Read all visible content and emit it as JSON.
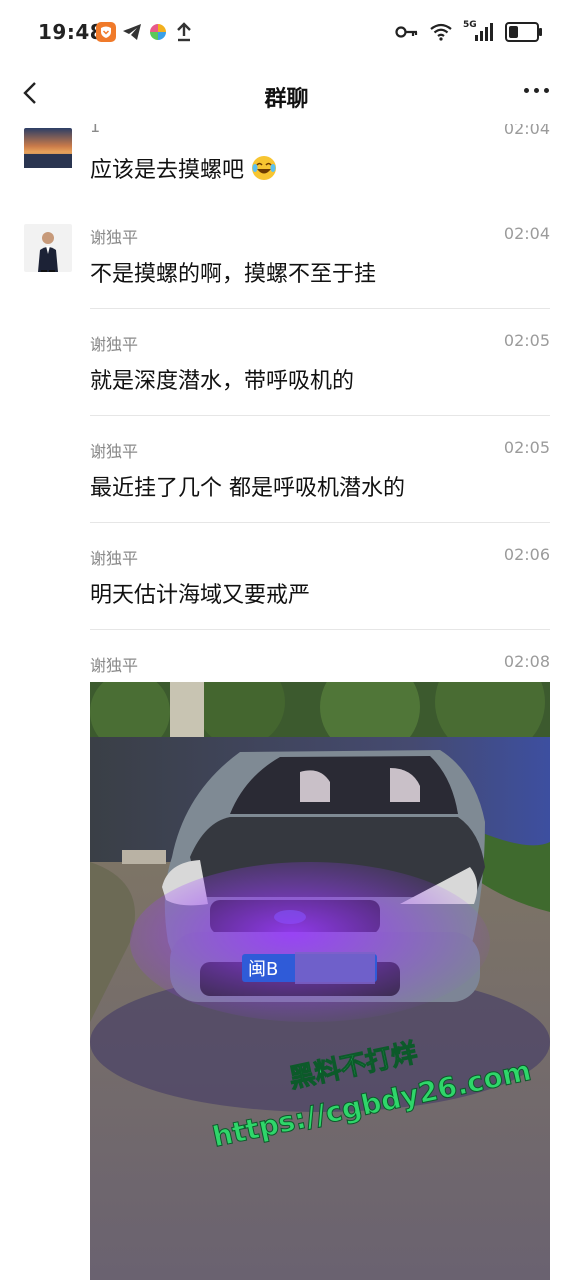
{
  "status_bar": {
    "time": "19:48",
    "left_icons": [
      "shield-app-icon",
      "telegram-icon",
      "pinwheel-icon",
      "upload-icon"
    ],
    "right_icons": [
      "key-icon",
      "wifi-icon",
      "5g-signal-icon",
      "battery-icon"
    ],
    "network_label": "5G",
    "battery_level_percent": 35
  },
  "nav": {
    "title": "群聊"
  },
  "messages": [
    {
      "sender": "1",
      "time": "02:04",
      "text": "应该是去摸螺吧",
      "emoji": "laughing-crying-emoji"
    },
    {
      "sender": "谢独平",
      "time": "02:04",
      "text": "不是摸螺的啊，摸螺不至于挂"
    },
    {
      "sender": "谢独平",
      "time": "02:05",
      "text": "就是深度潜水，带呼吸机的"
    },
    {
      "sender": "谢独平",
      "time": "02:05",
      "text": "最近挂了几个 都是呼吸机潜水的"
    },
    {
      "sender": "谢独平",
      "time": "02:06",
      "text": "明天估计海域又要戒严"
    },
    {
      "sender": "谢独平",
      "time": "02:08",
      "image": "car-photo"
    }
  ],
  "photo": {
    "plate_text": "闽B",
    "watermark_line1": "黑料不打烊",
    "watermark_line2": "https://cgbdy26.com"
  },
  "colors": {
    "divider": "#e6e6e6",
    "meta_text": "#8a8a8a",
    "watermark": "#2fd66a"
  }
}
